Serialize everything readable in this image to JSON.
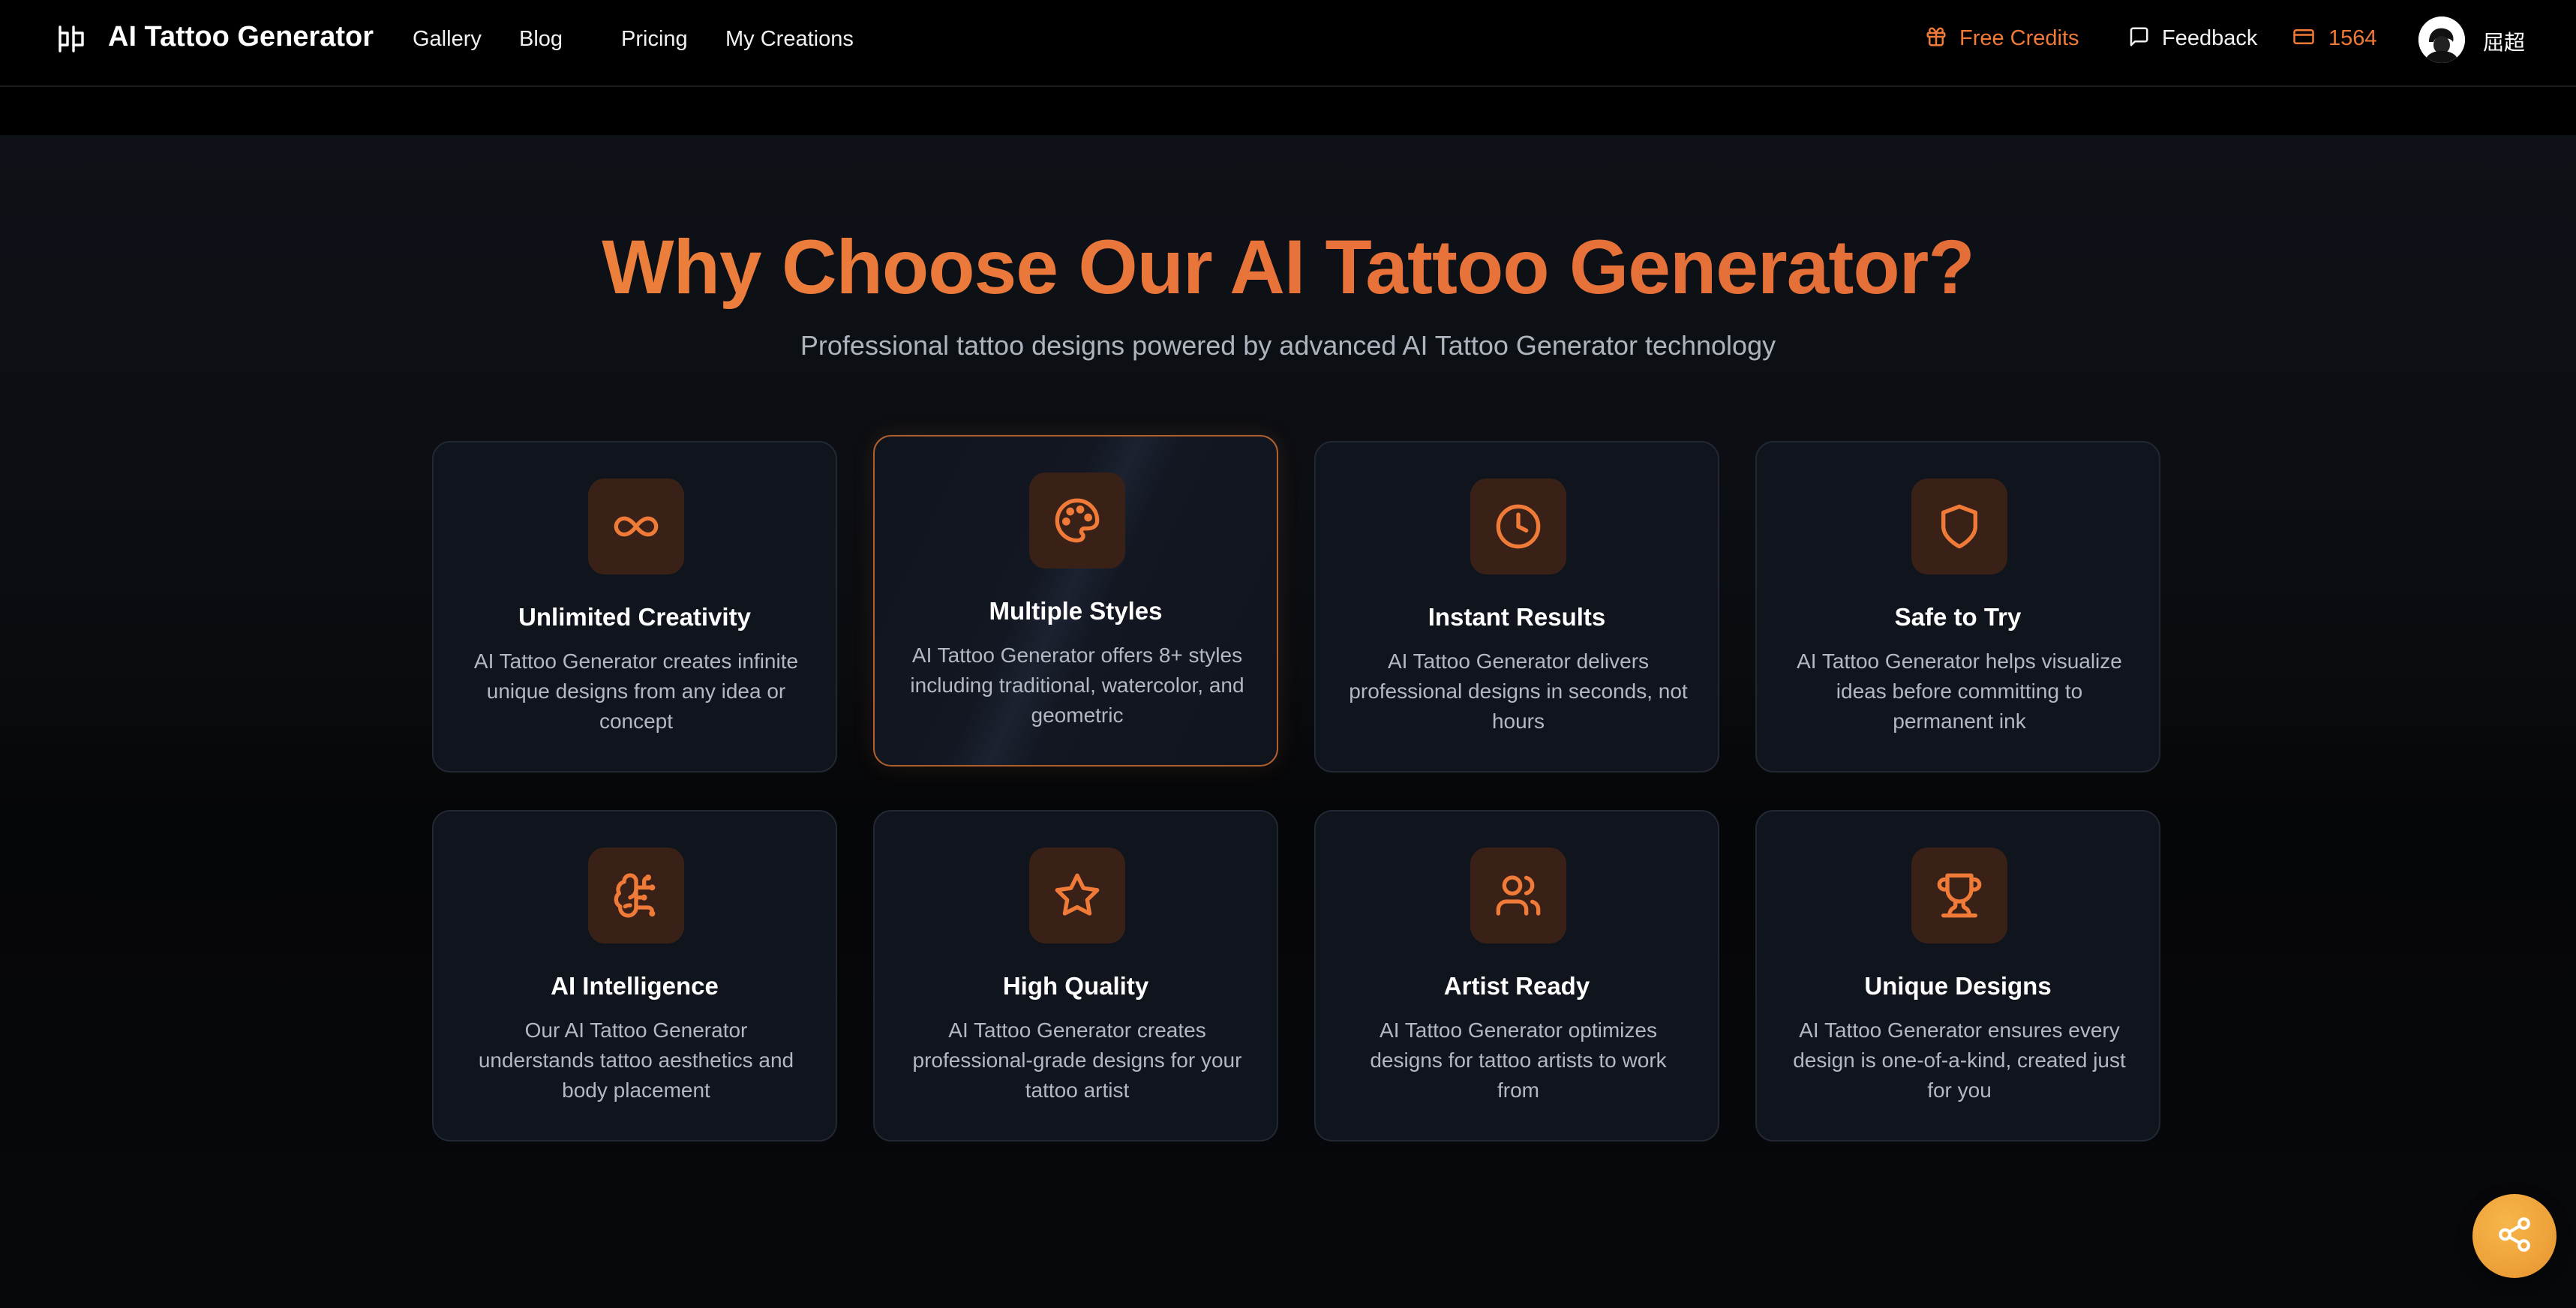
{
  "header": {
    "brand": "AI Tattoo Generator",
    "nav": [
      "Gallery",
      "Blog",
      "Pricing",
      "My Creations"
    ],
    "free_credits": "Free Credits",
    "feedback": "Feedback",
    "credits_balance": "1564",
    "username": "屈超"
  },
  "section": {
    "title": "Why Choose Our AI Tattoo Generator?",
    "subtitle": "Professional tattoo designs powered by advanced AI Tattoo Generator technology"
  },
  "features": [
    {
      "icon": "infinity-icon",
      "title": "Unlimited Creativity",
      "desc": "AI Tattoo Generator creates infinite unique designs from any idea or concept"
    },
    {
      "icon": "palette-icon",
      "title": "Multiple Styles",
      "desc": "AI Tattoo Generator offers 8+ styles including traditional, watercolor, and geometric"
    },
    {
      "icon": "clock-icon",
      "title": "Instant Results",
      "desc": "AI Tattoo Generator delivers professional designs in seconds, not hours"
    },
    {
      "icon": "shield-icon",
      "title": "Safe to Try",
      "desc": "AI Tattoo Generator helps visualize ideas before committing to permanent ink"
    },
    {
      "icon": "brain-icon",
      "title": "AI Intelligence",
      "desc": "Our AI Tattoo Generator understands tattoo aesthetics and body placement"
    },
    {
      "icon": "star-icon",
      "title": "High Quality",
      "desc": "AI Tattoo Generator creates professional-grade designs for your tattoo artist"
    },
    {
      "icon": "users-icon",
      "title": "Artist Ready",
      "desc": "AI Tattoo Generator optimizes designs for tattoo artists to work from"
    },
    {
      "icon": "trophy-icon",
      "title": "Unique Designs",
      "desc": "AI Tattoo Generator ensures every design is one-of-a-kind, created just for you"
    }
  ],
  "colors": {
    "accent": "#f07a38",
    "icon_bg": "#3a2118",
    "card_bg": "#10141c",
    "share_button": "#eea23a"
  }
}
